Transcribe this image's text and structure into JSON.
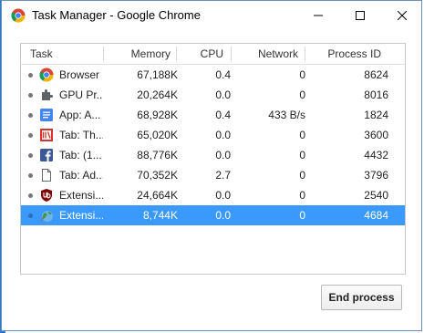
{
  "window": {
    "title": "Task Manager - Google Chrome"
  },
  "columns": {
    "task": "Task",
    "memory": "Memory",
    "cpu": "CPU",
    "network": "Network",
    "pid": "Process ID"
  },
  "rows": [
    {
      "task": "Browser",
      "memory": "67,188K",
      "cpu": "0.4",
      "network": "0",
      "pid": "8624",
      "icon": "chrome-icon"
    },
    {
      "task": "GPU Pr...",
      "memory": "20,264K",
      "cpu": "0.0",
      "network": "0",
      "pid": "8016",
      "icon": "puzzle-icon"
    },
    {
      "task": "App: A...",
      "memory": "68,928K",
      "cpu": "0.4",
      "network": "433 B/s",
      "pid": "1824",
      "icon": "docs-icon"
    },
    {
      "task": "Tab: Th...",
      "memory": "65,020K",
      "cpu": "0.0",
      "network": "0",
      "pid": "3600",
      "icon": "page-red-icon"
    },
    {
      "task": "Tab: (1...",
      "memory": "88,776K",
      "cpu": "0.0",
      "network": "0",
      "pid": "4432",
      "icon": "facebook-icon"
    },
    {
      "task": "Tab: Ad...",
      "memory": "70,352K",
      "cpu": "2.7",
      "network": "0",
      "pid": "3796",
      "icon": "blank-page-icon"
    },
    {
      "task": "Extensi...",
      "memory": "24,664K",
      "cpu": "0.0",
      "network": "0",
      "pid": "2540",
      "icon": "ublock-icon"
    },
    {
      "task": "Extensi...",
      "memory": "8,744K",
      "cpu": "0.0",
      "network": "0",
      "pid": "4684",
      "icon": "extension-globe-icon",
      "selected": true
    }
  ],
  "buttons": {
    "end_process": "End process"
  }
}
